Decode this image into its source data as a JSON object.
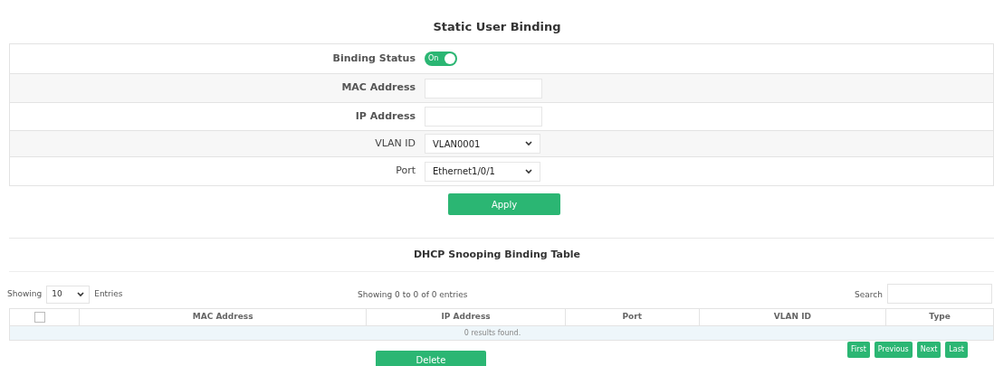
{
  "form": {
    "title": "Static User Binding",
    "rows": [
      {
        "kind": "toggle",
        "label": "Binding Status",
        "on": true,
        "text": "On"
      },
      {
        "kind": "text",
        "label": "MAC Address"
      },
      {
        "kind": "text",
        "label": "IP Address"
      },
      {
        "kind": "select",
        "label": "VLAN ID",
        "value": "VLAN0001"
      },
      {
        "kind": "select",
        "label": "Port",
        "value": "Ethernet1/0/1"
      }
    ],
    "apply": "Apply"
  },
  "table_section": {
    "title": "DHCP Snooping Binding Table",
    "length": {
      "before": "Showing",
      "value": "10",
      "after": "Entries"
    },
    "info": "Showing 0 to 0 of 0 entries",
    "search_label": "Search",
    "select_all": {
      "checked": false
    },
    "columns": [
      "MAC Address",
      "IP Address",
      "Port",
      "VLAN ID",
      "Type"
    ],
    "empty": "0 results found.",
    "delete": "Delete",
    "pagination": [
      "First",
      "Previous",
      "Next",
      "Last"
    ]
  }
}
